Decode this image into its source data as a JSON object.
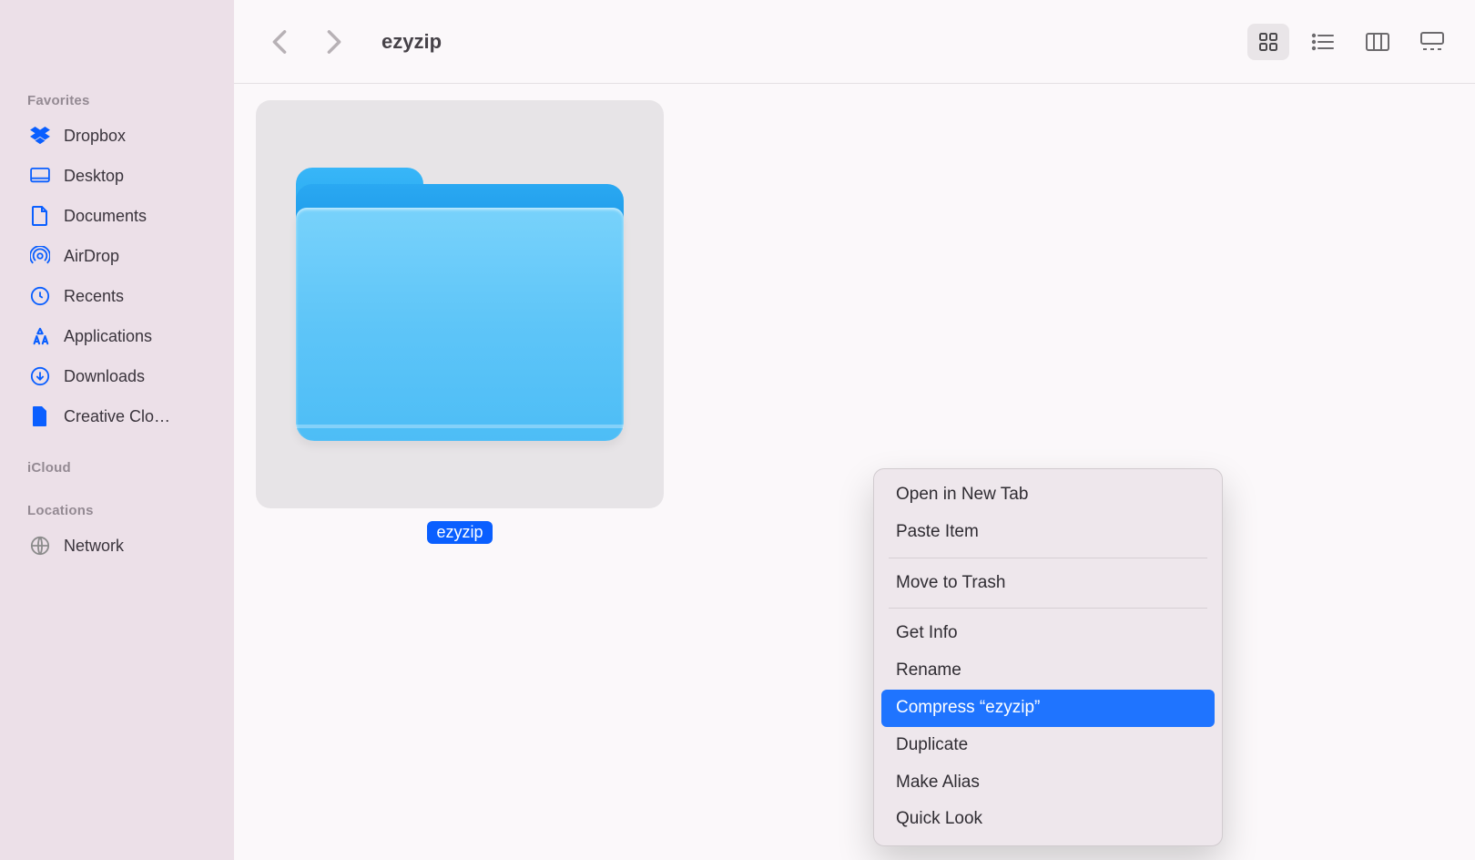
{
  "toolbar": {
    "title": "ezyzip"
  },
  "sidebar": {
    "sections": [
      {
        "header": "Favorites"
      },
      {
        "header": "iCloud"
      },
      {
        "header": "Locations"
      }
    ],
    "favorites": [
      {
        "label": "Dropbox"
      },
      {
        "label": "Desktop"
      },
      {
        "label": "Documents"
      },
      {
        "label": "AirDrop"
      },
      {
        "label": "Recents"
      },
      {
        "label": "Applications"
      },
      {
        "label": "Downloads"
      },
      {
        "label": "Creative Clo…"
      }
    ],
    "locations": [
      {
        "label": "Network"
      }
    ]
  },
  "content": {
    "selected_folder_label": "ezyzip"
  },
  "context_menu": {
    "items": [
      {
        "label": "Open in New Tab",
        "highlight": false
      },
      {
        "label": "Paste Item",
        "highlight": false
      },
      {
        "sep": true
      },
      {
        "label": "Move to Trash",
        "highlight": false
      },
      {
        "sep": true
      },
      {
        "label": "Get Info",
        "highlight": false
      },
      {
        "label": "Rename",
        "highlight": false
      },
      {
        "label": "Compress “ezyzip”",
        "highlight": true
      },
      {
        "label": "Duplicate",
        "highlight": false
      },
      {
        "label": "Make Alias",
        "highlight": false
      },
      {
        "label": "Quick Look",
        "highlight": false
      }
    ]
  }
}
